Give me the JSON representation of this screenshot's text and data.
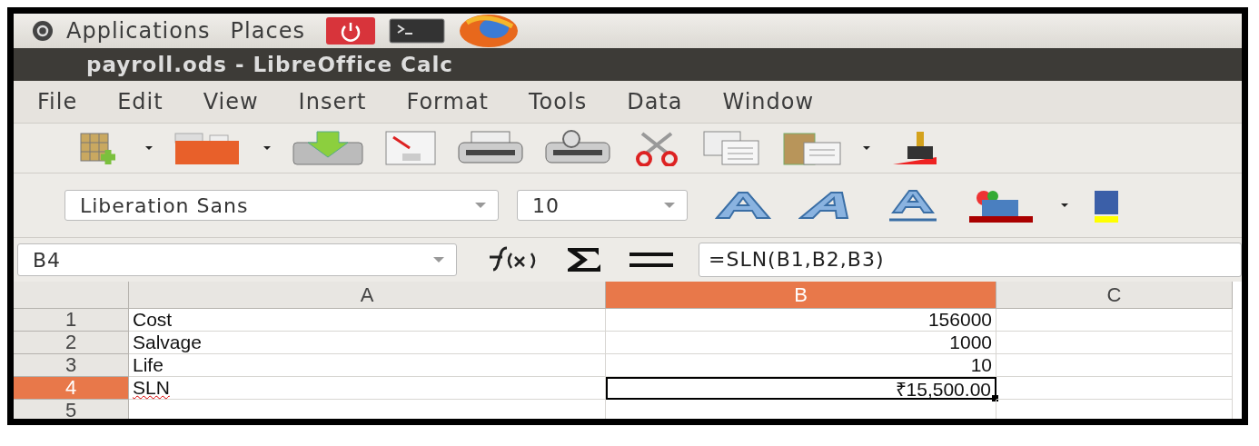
{
  "top_panel": {
    "menus": [
      "Applications",
      "Places"
    ]
  },
  "window": {
    "title": "payroll.ods - LibreOffice Calc"
  },
  "menu_bar": [
    "File",
    "Edit",
    "View",
    "Insert",
    "Format",
    "Tools",
    "Data",
    "Window"
  ],
  "formatting_toolbar": {
    "font_name": "Liberation Sans",
    "font_size": "10"
  },
  "formula_bar": {
    "name_box": "B4",
    "formula": "=SLN(B1,B2,B3)"
  },
  "sheet": {
    "columns": [
      {
        "label": "A",
        "selected": false
      },
      {
        "label": "B",
        "selected": true
      },
      {
        "label": "C",
        "selected": false
      }
    ],
    "rows": [
      {
        "number": "1",
        "selected": false,
        "cells": [
          {
            "text": "Cost",
            "selected": false,
            "misspelled": false
          },
          {
            "text": "156000",
            "selected": false,
            "misspelled": false
          }
        ]
      },
      {
        "number": "2",
        "selected": false,
        "cells": [
          {
            "text": "Salvage",
            "selected": false,
            "misspelled": false
          },
          {
            "text": "1000",
            "selected": false,
            "misspelled": false
          }
        ]
      },
      {
        "number": "3",
        "selected": false,
        "cells": [
          {
            "text": "Life",
            "selected": false,
            "misspelled": false
          },
          {
            "text": "10",
            "selected": false,
            "misspelled": false
          }
        ]
      },
      {
        "number": "4",
        "selected": true,
        "cells": [
          {
            "text": "SLN",
            "selected": false,
            "misspelled": true
          },
          {
            "text": "₹15,500.00",
            "selected": true,
            "misspelled": false
          }
        ]
      },
      {
        "number": "5",
        "selected": false,
        "cells": []
      }
    ]
  }
}
